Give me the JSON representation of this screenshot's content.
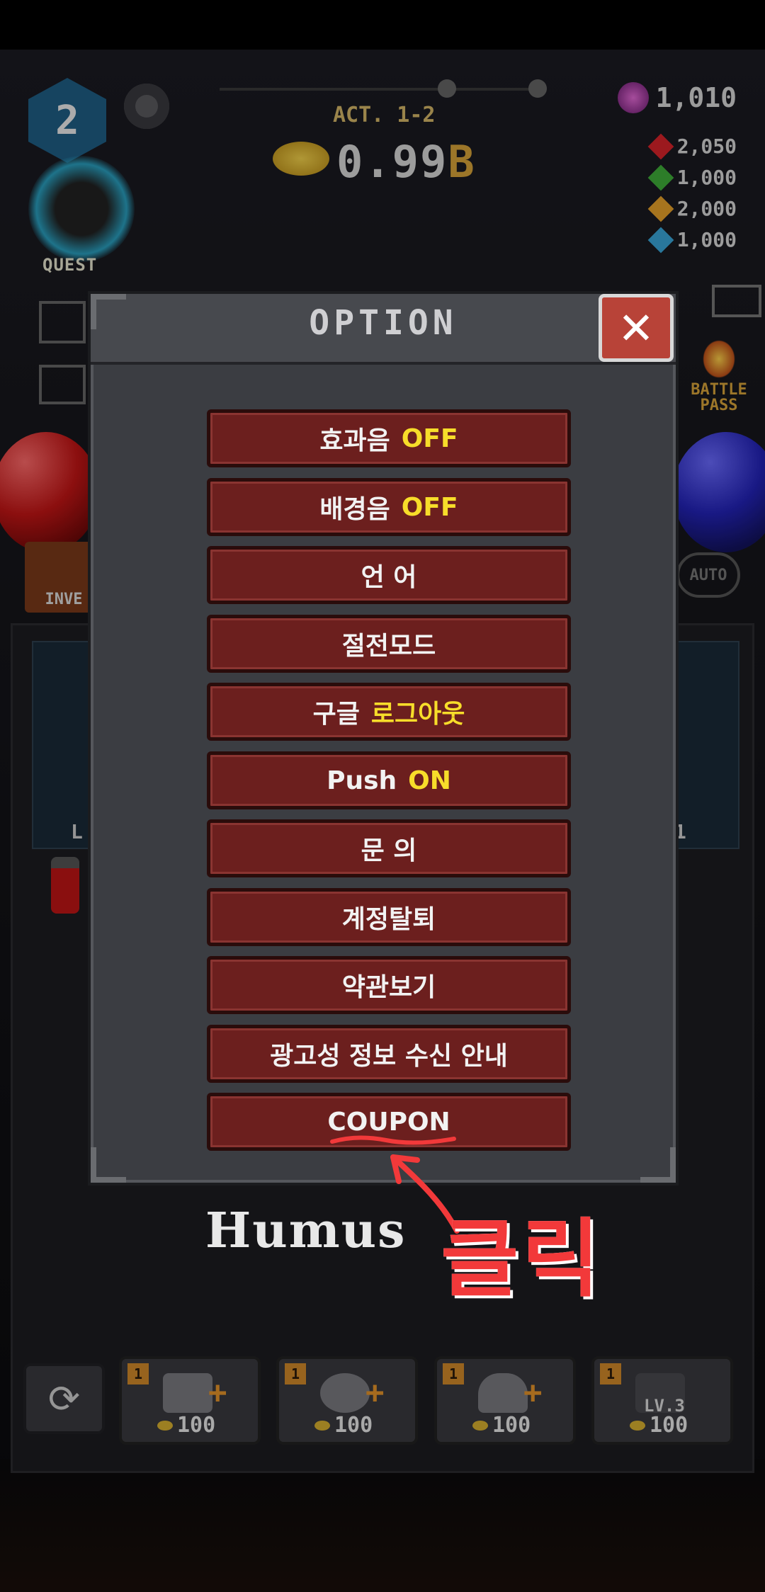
{
  "hud": {
    "player_level": "2",
    "quest_label": "QUEST",
    "act": "ACT. 1-2",
    "gold_value": "0.99",
    "gold_unit": "B",
    "orb_count": "1,010",
    "resources": [
      {
        "color": "#d8232a",
        "value": "2,050"
      },
      {
        "color": "#3fae3a",
        "value": "1,000"
      },
      {
        "color": "#e7a12a",
        "value": "2,000"
      },
      {
        "color": "#3aa6d8",
        "value": "1,000"
      }
    ],
    "battle_pass_label": "BATTLE PASS",
    "inventory_label": "INVE",
    "auto_label": "AUTO"
  },
  "option_dialog": {
    "title": "OPTION",
    "items": [
      {
        "label": "효과음",
        "value": "OFF"
      },
      {
        "label": "배경음",
        "value": "OFF"
      },
      {
        "label": "언 어",
        "value": ""
      },
      {
        "label": "절전모드",
        "value": ""
      },
      {
        "label": "구글",
        "value": "로그아웃"
      },
      {
        "label": "Push",
        "value": "ON"
      },
      {
        "label": "문 의",
        "value": ""
      },
      {
        "label": "계정탈퇴",
        "value": ""
      },
      {
        "label": "약관보기",
        "value": ""
      },
      {
        "label": "광고성 정보 수신 안내",
        "value": ""
      },
      {
        "label": "COUPON",
        "value": ""
      }
    ]
  },
  "shop": {
    "items": [
      {
        "badge": "1",
        "cost": "100",
        "lock": ""
      },
      {
        "badge": "1",
        "cost": "100",
        "lock": ""
      },
      {
        "badge": "1",
        "cost": "100",
        "lock": ""
      },
      {
        "badge": "1",
        "cost": "100",
        "lock": "LV.3"
      }
    ]
  },
  "annotation": {
    "click_label": "클릭",
    "watermark": "Humus",
    "color": "#f2393a"
  },
  "side_labels": {
    "left_slot_letter": "L",
    "right_slot_letter": "1"
  }
}
